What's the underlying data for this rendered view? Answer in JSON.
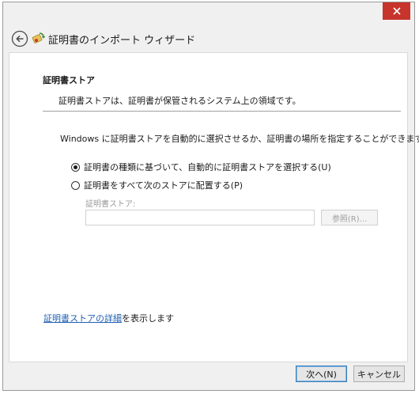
{
  "window": {
    "close_icon": "close-icon"
  },
  "header": {
    "back_icon": "back-arrow-icon",
    "wizard_icon": "certificate-icon",
    "title": "証明書のインポート ウィザード"
  },
  "section": {
    "title": "証明書ストア",
    "description": "証明書ストアは、証明書が保管されるシステム上の領域です。"
  },
  "main": {
    "intro": "Windows に証明書ストアを自動的に選択させるか、証明書の場所を指定することができます。",
    "options": [
      {
        "label": "証明書の種類に基づいて、自動的に証明書ストアを選択する(U)",
        "selected": true
      },
      {
        "label": "証明書をすべて次のストアに配置する(P)",
        "selected": false
      }
    ],
    "store_label": "証明書ストア:",
    "store_value": "",
    "browse_label": "参照(R)..."
  },
  "more_info": {
    "link_text": "証明書ストアの詳細",
    "suffix": "を表示します"
  },
  "footer": {
    "next_label": "次へ(N)",
    "cancel_label": "キャンセル"
  },
  "colors": {
    "close_bg": "#c7342c",
    "link": "#1f5fb4",
    "accent_border": "#3c7fb1"
  }
}
